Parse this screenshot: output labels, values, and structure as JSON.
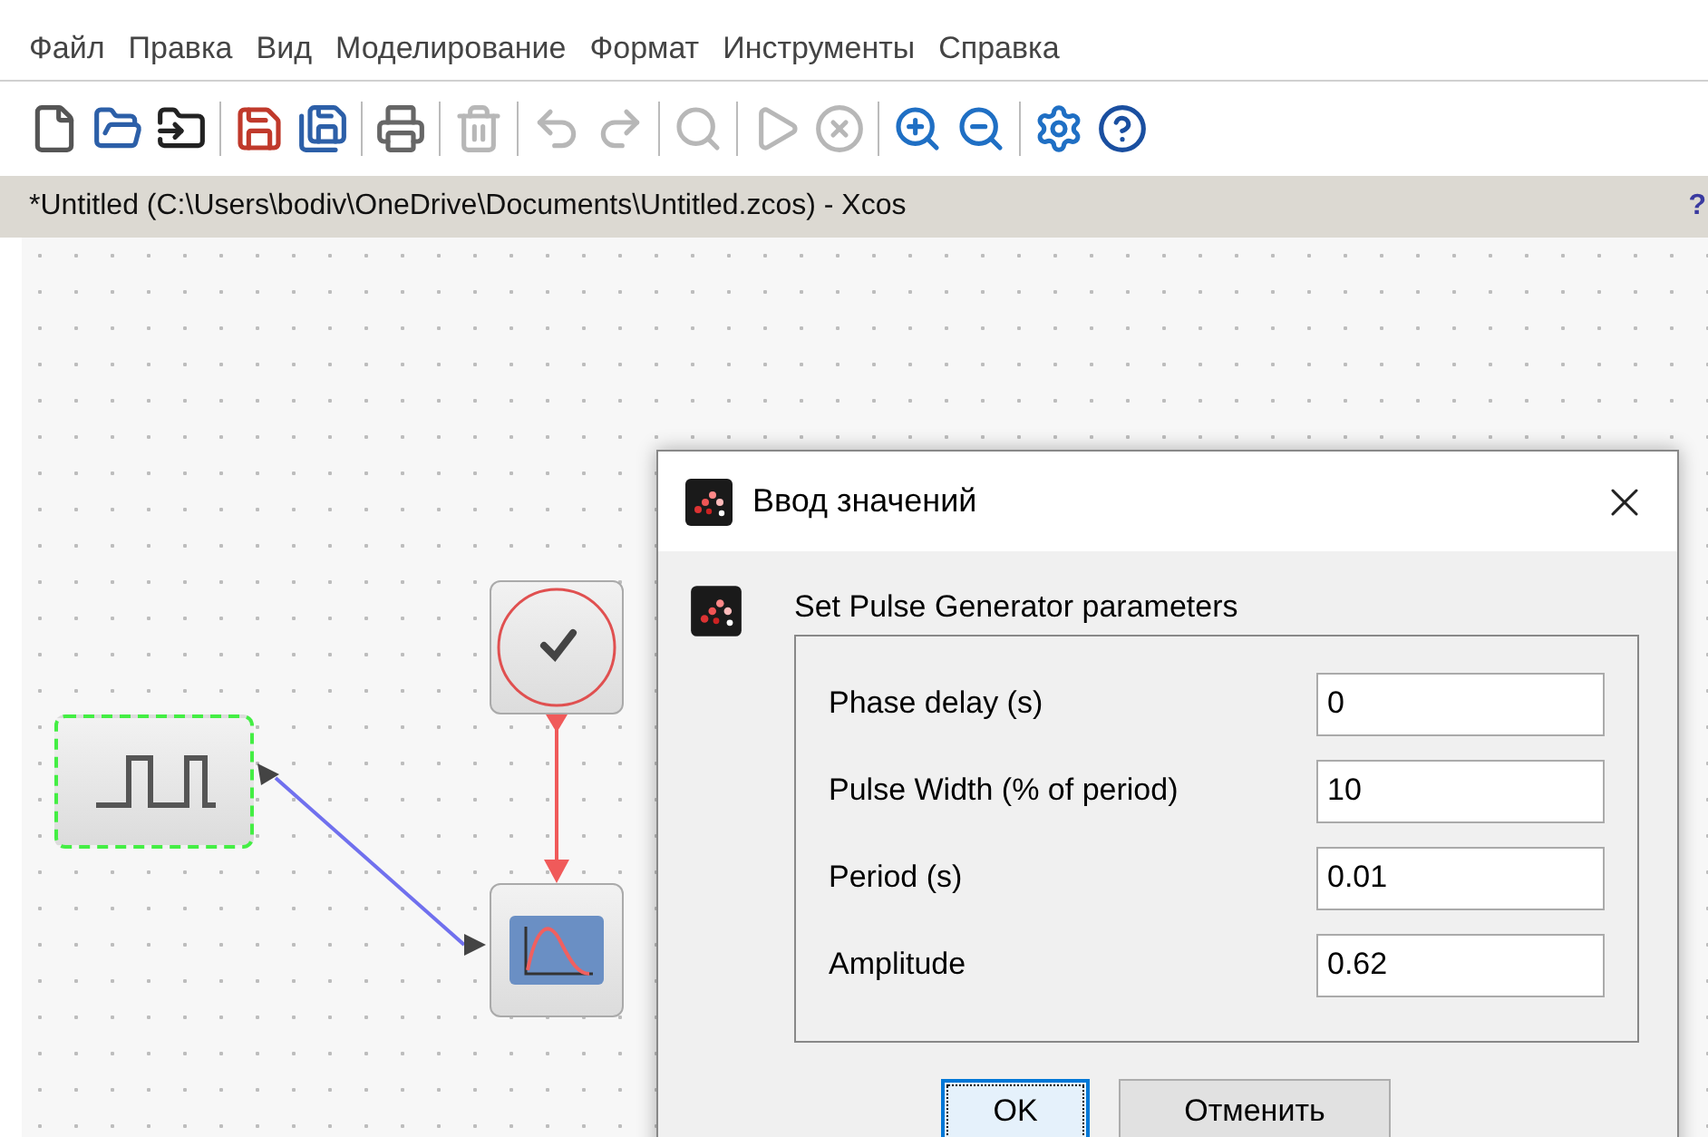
{
  "menu": [
    "Файл",
    "Правка",
    "Вид",
    "Моделирование",
    "Формат",
    "Инструменты",
    "Справка"
  ],
  "toolbar": [
    {
      "kind": "new",
      "disabled": false
    },
    {
      "kind": "open",
      "disabled": false
    },
    {
      "kind": "open-scilab",
      "disabled": false
    },
    {
      "kind": "separator"
    },
    {
      "kind": "save",
      "disabled": false
    },
    {
      "kind": "save-as",
      "disabled": false
    },
    {
      "kind": "separator"
    },
    {
      "kind": "print",
      "disabled": false
    },
    {
      "kind": "separator"
    },
    {
      "kind": "delete",
      "disabled": true
    },
    {
      "kind": "separator"
    },
    {
      "kind": "undo",
      "disabled": true
    },
    {
      "kind": "redo",
      "disabled": true
    },
    {
      "kind": "separator"
    },
    {
      "kind": "zoom-fit",
      "disabled": true
    },
    {
      "kind": "separator"
    },
    {
      "kind": "start",
      "disabled": true
    },
    {
      "kind": "stop",
      "disabled": true
    },
    {
      "kind": "separator"
    },
    {
      "kind": "zoom-in",
      "disabled": false
    },
    {
      "kind": "zoom-out",
      "disabled": false
    },
    {
      "kind": "separator"
    },
    {
      "kind": "settings",
      "disabled": false
    },
    {
      "kind": "help",
      "disabled": false
    }
  ],
  "document_bar": {
    "title": "*Untitled (C:\\Users\\bodiv\\OneDrive\\Documents\\Untitled.zcos) - Xcos",
    "help": "?"
  },
  "diagram": {
    "blocks": [
      {
        "kind": "pulse",
        "selected": true
      },
      {
        "kind": "clock",
        "selected": false
      },
      {
        "kind": "scope",
        "selected": false
      }
    ]
  },
  "dialog": {
    "title": "Ввод значений",
    "heading": "Set Pulse Generator parameters",
    "fields": [
      {
        "label": "Phase delay (s)",
        "value": "0"
      },
      {
        "label": "Pulse Width (% of period)",
        "value": "10"
      },
      {
        "label": "Period (s)",
        "value": "0.01"
      },
      {
        "label": "Amplitude",
        "value": "0.62"
      }
    ],
    "buttons": [
      {
        "label": "OK",
        "focused": true
      },
      {
        "label": "Отменить",
        "focused": false
      }
    ]
  }
}
